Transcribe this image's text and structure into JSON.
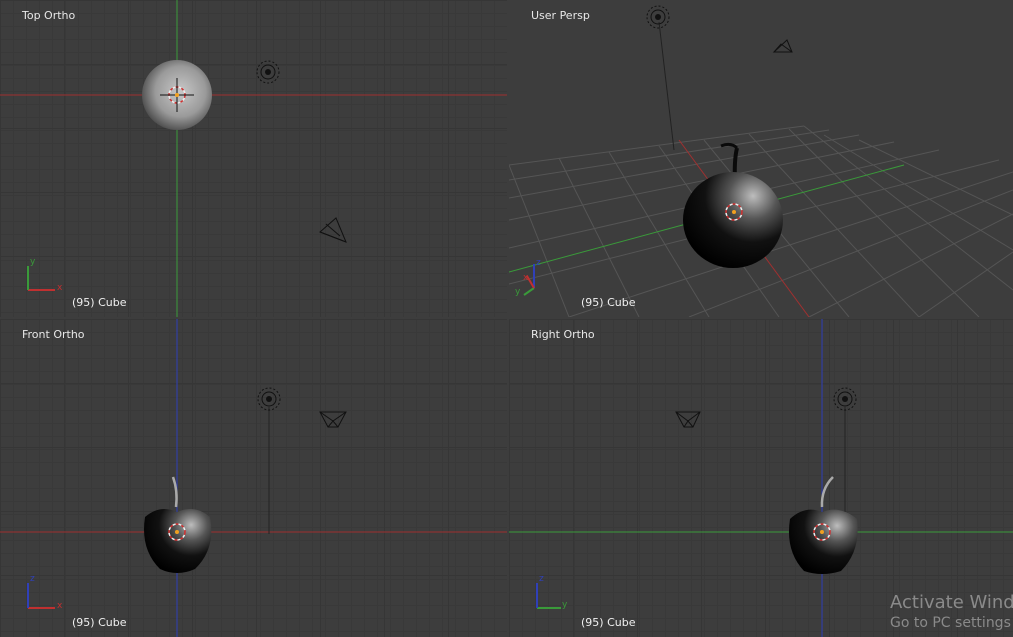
{
  "viewports": {
    "top": {
      "title": "Top Ortho",
      "object_label": "(95) Cube"
    },
    "persp": {
      "title": "User Persp",
      "object_label": "(95) Cube"
    },
    "front": {
      "title": "Front Ortho",
      "object_label": "(95) Cube"
    },
    "right": {
      "title": "Right Ortho",
      "object_label": "(95) Cube"
    }
  },
  "axis_labels": {
    "x": "x",
    "y": "y",
    "z": "z"
  },
  "watermark": {
    "title": "Activate Wind",
    "subtitle": "Go to PC settings t"
  },
  "colors": {
    "background": "#3d3d3d",
    "x_axis": "#a03030",
    "y_axis": "#3a9a3a",
    "z_axis": "#3040b8",
    "cursor_ring": "#d03030",
    "origin": "#f0a020"
  },
  "icons": [
    "lamp-icon",
    "camera-icon",
    "3d-cursor-icon",
    "axis-gizmo-icon"
  ]
}
